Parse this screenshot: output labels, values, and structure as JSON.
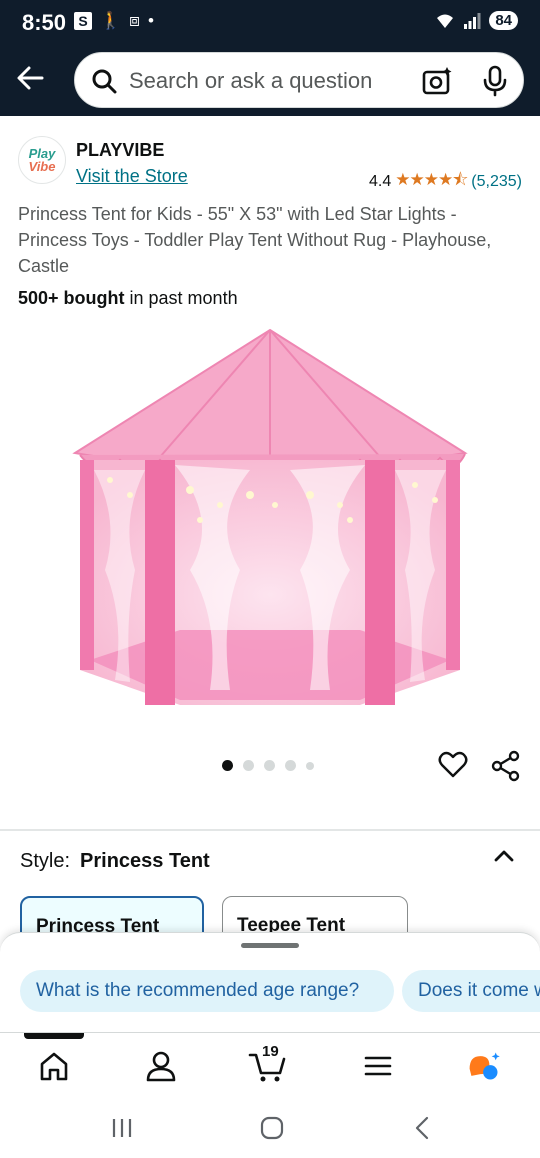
{
  "status_bar": {
    "time": "8:50",
    "s_badge": "S",
    "battery": "84"
  },
  "search": {
    "placeholder": "Search or ask a question"
  },
  "store": {
    "logo_top": "Play",
    "logo_bottom": "Vibe",
    "brand": "PLAYVIBE",
    "visit_link": "Visit the Store",
    "rating": "4.4",
    "stars": "★★★★⯪",
    "rating_count": "(5,235)"
  },
  "product": {
    "title": "Princess Tent for Kids - 55\" X 53\" with Led Star Lights - Princess Toys - Toddler Play Tent Without Rug - Playhouse, Castle",
    "bought_count": "500+ bought",
    "bought_suffix": " in past month",
    "image_slides": 5,
    "active_slide": 1
  },
  "style": {
    "label": "Style:",
    "value": "Princess Tent",
    "options": [
      "Princess Tent",
      "Teepee Tent"
    ]
  },
  "suggestions": {
    "chips": [
      "What is the recommended age range?",
      "Does it come with"
    ]
  },
  "bottom_nav": {
    "cart_count": "19"
  },
  "colors": {
    "header_bg": "#0f1c2b",
    "link": "#007185",
    "star": "#de7921",
    "chip_bg": "#dff3fa",
    "selected_border": "#2162a1",
    "tent_pink": "#f48fb1"
  }
}
